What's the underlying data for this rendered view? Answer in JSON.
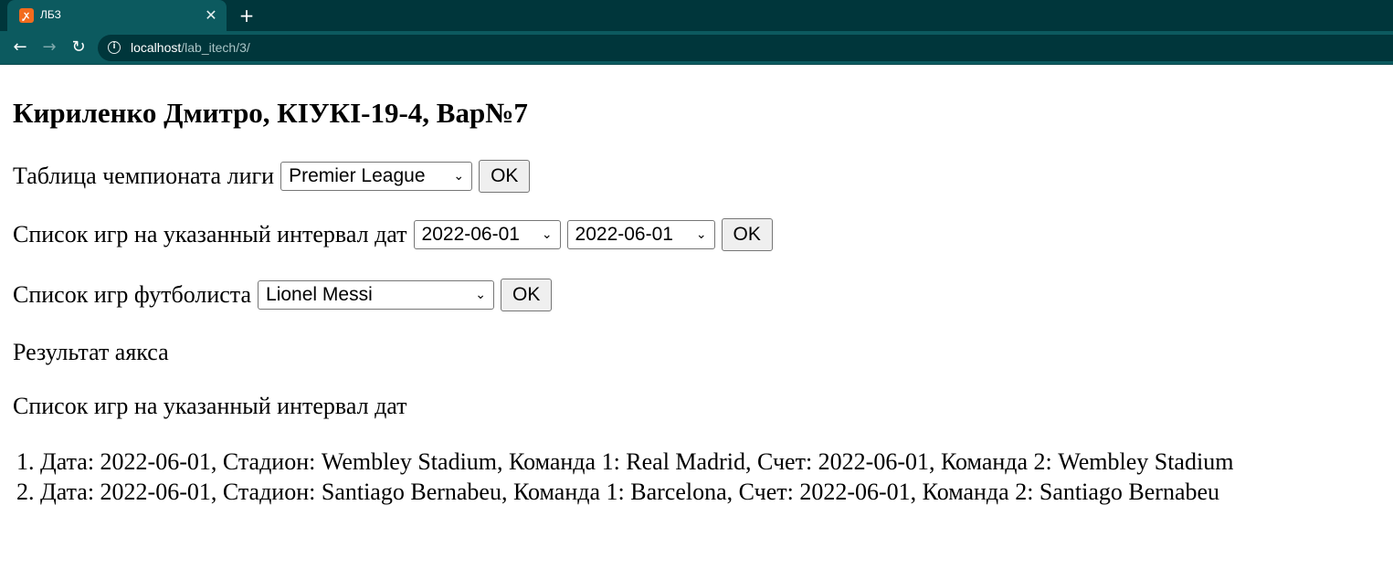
{
  "browser": {
    "tab_title": "ЛБЗ",
    "tab_favicon": "xampp-icon",
    "close_glyph": "✕",
    "new_tab_glyph": "+",
    "url_host": "localhost",
    "url_path": "/lab_itech/3/"
  },
  "page": {
    "heading": "Кириленко Дмитро, КІУКІ-19-4, Вар№7",
    "league": {
      "label": "Таблица чемпионата лиги",
      "selected": "Premier League",
      "button": "OK"
    },
    "dates": {
      "label": "Список игр на указанный интервал дат",
      "from": "2022-06-01",
      "to": "2022-06-01",
      "button": "OK"
    },
    "player": {
      "label": "Список игр футболиста",
      "selected": "Lionel Messi",
      "button": "OK"
    },
    "ajax_label": "Результат аякса",
    "result_title": "Список игр на указанный интервал дат",
    "games": [
      "Дата: 2022-06-01, Стадион: Wembley Stadium, Команда 1: Real Madrid, Счет: 2022-06-01, Команда 2: Wembley Stadium",
      "Дата: 2022-06-01, Стадион: Santiago Bernabeu, Команда 1: Barcelona, Счет: 2022-06-01, Команда 2: Santiago Bernabeu"
    ]
  }
}
